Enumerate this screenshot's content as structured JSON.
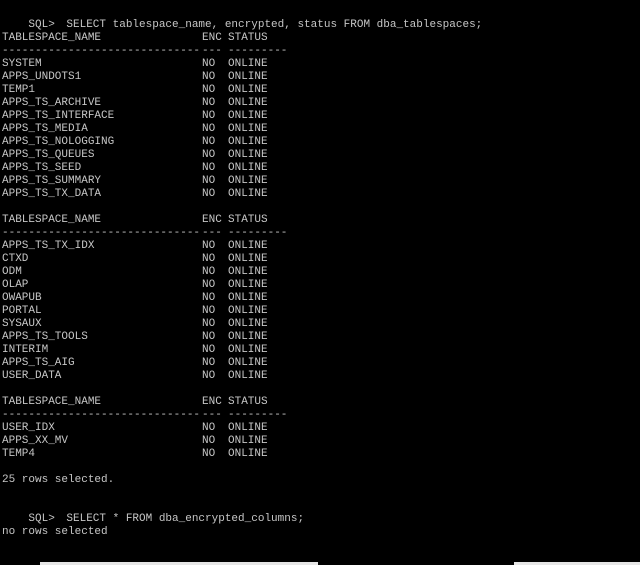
{
  "session": {
    "prompt": "SQL>",
    "command_1": "SELECT tablespace_name, encrypted, status FROM dba_tablespaces;",
    "command_2": "SELECT * FROM dba_encrypted_columns;",
    "result_count": "25 rows selected.",
    "result_empty": "no rows selected"
  },
  "table": {
    "headers": [
      "TABLESPACE_NAME",
      "ENC",
      "STATUS"
    ],
    "separators": [
      "------------------------------",
      "---",
      "---------"
    ],
    "pages": [
      [
        [
          "SYSTEM",
          "NO",
          "ONLINE"
        ],
        [
          "APPS_UNDOTS1",
          "NO",
          "ONLINE"
        ],
        [
          "TEMP1",
          "NO",
          "ONLINE"
        ],
        [
          "APPS_TS_ARCHIVE",
          "NO",
          "ONLINE"
        ],
        [
          "APPS_TS_INTERFACE",
          "NO",
          "ONLINE"
        ],
        [
          "APPS_TS_MEDIA",
          "NO",
          "ONLINE"
        ],
        [
          "APPS_TS_NOLOGGING",
          "NO",
          "ONLINE"
        ],
        [
          "APPS_TS_QUEUES",
          "NO",
          "ONLINE"
        ],
        [
          "APPS_TS_SEED",
          "NO",
          "ONLINE"
        ],
        [
          "APPS_TS_SUMMARY",
          "NO",
          "ONLINE"
        ],
        [
          "APPS_TS_TX_DATA",
          "NO",
          "ONLINE"
        ]
      ],
      [
        [
          "APPS_TS_TX_IDX",
          "NO",
          "ONLINE"
        ],
        [
          "CTXD",
          "NO",
          "ONLINE"
        ],
        [
          "ODM",
          "NO",
          "ONLINE"
        ],
        [
          "OLAP",
          "NO",
          "ONLINE"
        ],
        [
          "OWAPUB",
          "NO",
          "ONLINE"
        ],
        [
          "PORTAL",
          "NO",
          "ONLINE"
        ],
        [
          "SYSAUX",
          "NO",
          "ONLINE"
        ],
        [
          "APPS_TS_TOOLS",
          "NO",
          "ONLINE"
        ],
        [
          "INTERIM",
          "NO",
          "ONLINE"
        ],
        [
          "APPS_TS_AIG",
          "NO",
          "ONLINE"
        ],
        [
          "USER_DATA",
          "NO",
          "ONLINE"
        ]
      ],
      [
        [
          "USER_IDX",
          "NO",
          "ONLINE"
        ],
        [
          "APPS_XX_MV",
          "NO",
          "ONLINE"
        ],
        [
          "TEMP4",
          "NO",
          "ONLINE"
        ]
      ]
    ]
  },
  "colors": {
    "background": "#000000",
    "text": "#c6c6c6",
    "bottom_bar": "#e6e6e6"
  }
}
